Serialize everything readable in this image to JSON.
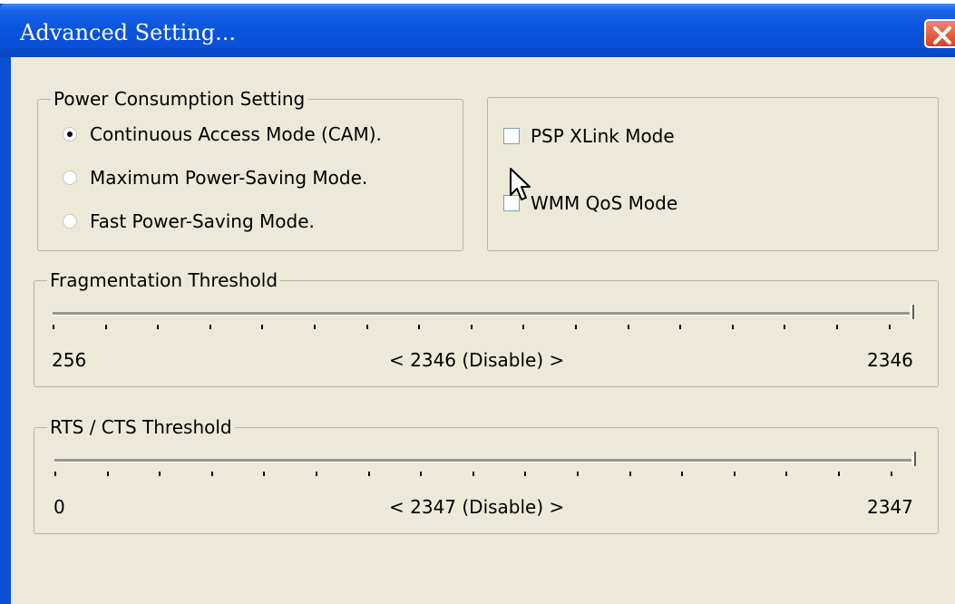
{
  "window": {
    "title": "Advanced Setting..."
  },
  "power": {
    "legend": "Power Consumption Setting",
    "options": [
      {
        "label": "Continuous Access Mode (CAM).",
        "selected": true
      },
      {
        "label": "Maximum Power-Saving Mode.",
        "selected": false
      },
      {
        "label": "Fast Power-Saving Mode.",
        "selected": false
      }
    ]
  },
  "modes": {
    "psp_xlink": {
      "label": "PSP XLink Mode",
      "checked": false
    },
    "wmm_qos": {
      "label": "WMM QoS Mode",
      "checked": false
    }
  },
  "fragmentation": {
    "legend": "Fragmentation Threshold",
    "min": "256",
    "current": "< 2346 (Disable) >",
    "max": "2346",
    "value": 2346
  },
  "rts_cts": {
    "legend": "RTS / CTS Threshold",
    "min": "0",
    "current": "< 2347 (Disable) >",
    "max": "2347",
    "value": 2347
  },
  "colors": {
    "titlebar": "#0a4fd6",
    "dialog_face": "#ece9d8",
    "close_button": "#d8401e"
  },
  "icons": {
    "close": "close-icon",
    "pointer": "mouse-pointer-icon"
  }
}
